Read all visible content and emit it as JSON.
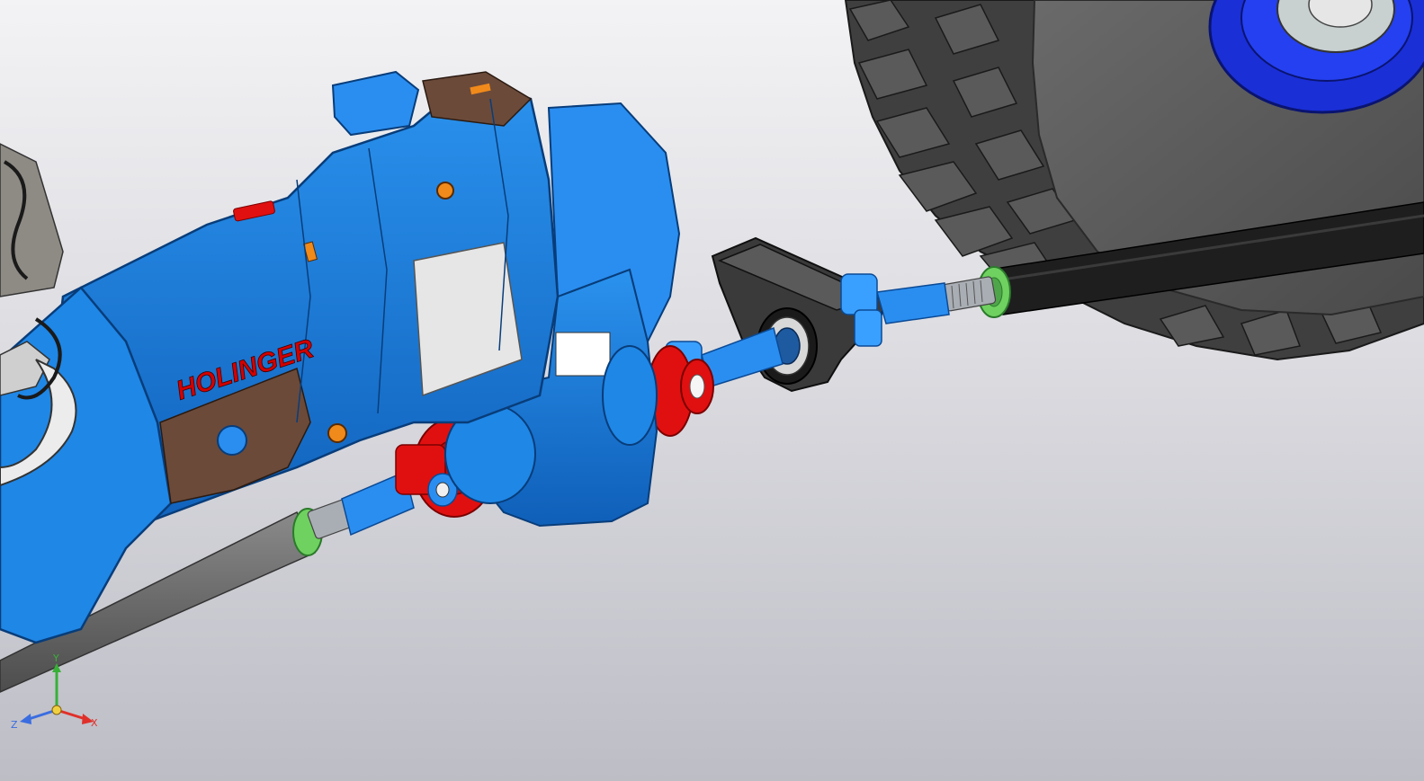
{
  "viewport": {
    "background_top": "#f3f3f5",
    "background_bottom": "#bdbdc6"
  },
  "model": {
    "brand_label": "HOLINGER",
    "colors": {
      "gearbox_blue": "#1c7fe0",
      "gearbox_dark": "#0d4f9c",
      "joint_red": "#e01010",
      "spline_green": "#6fd160",
      "shaft_black": "#1e1e1e",
      "shaft_grey": "#6b6b6b",
      "tire_grey": "#5c5c5c",
      "hub_blue": "#1a2fd6",
      "engine_grey": "#8e8a84"
    }
  },
  "triad": {
    "x_label": "X",
    "y_label": "Y",
    "z_label": "Z",
    "x_color": "#e0302a",
    "y_color": "#38b038",
    "z_color": "#3a6de0"
  }
}
